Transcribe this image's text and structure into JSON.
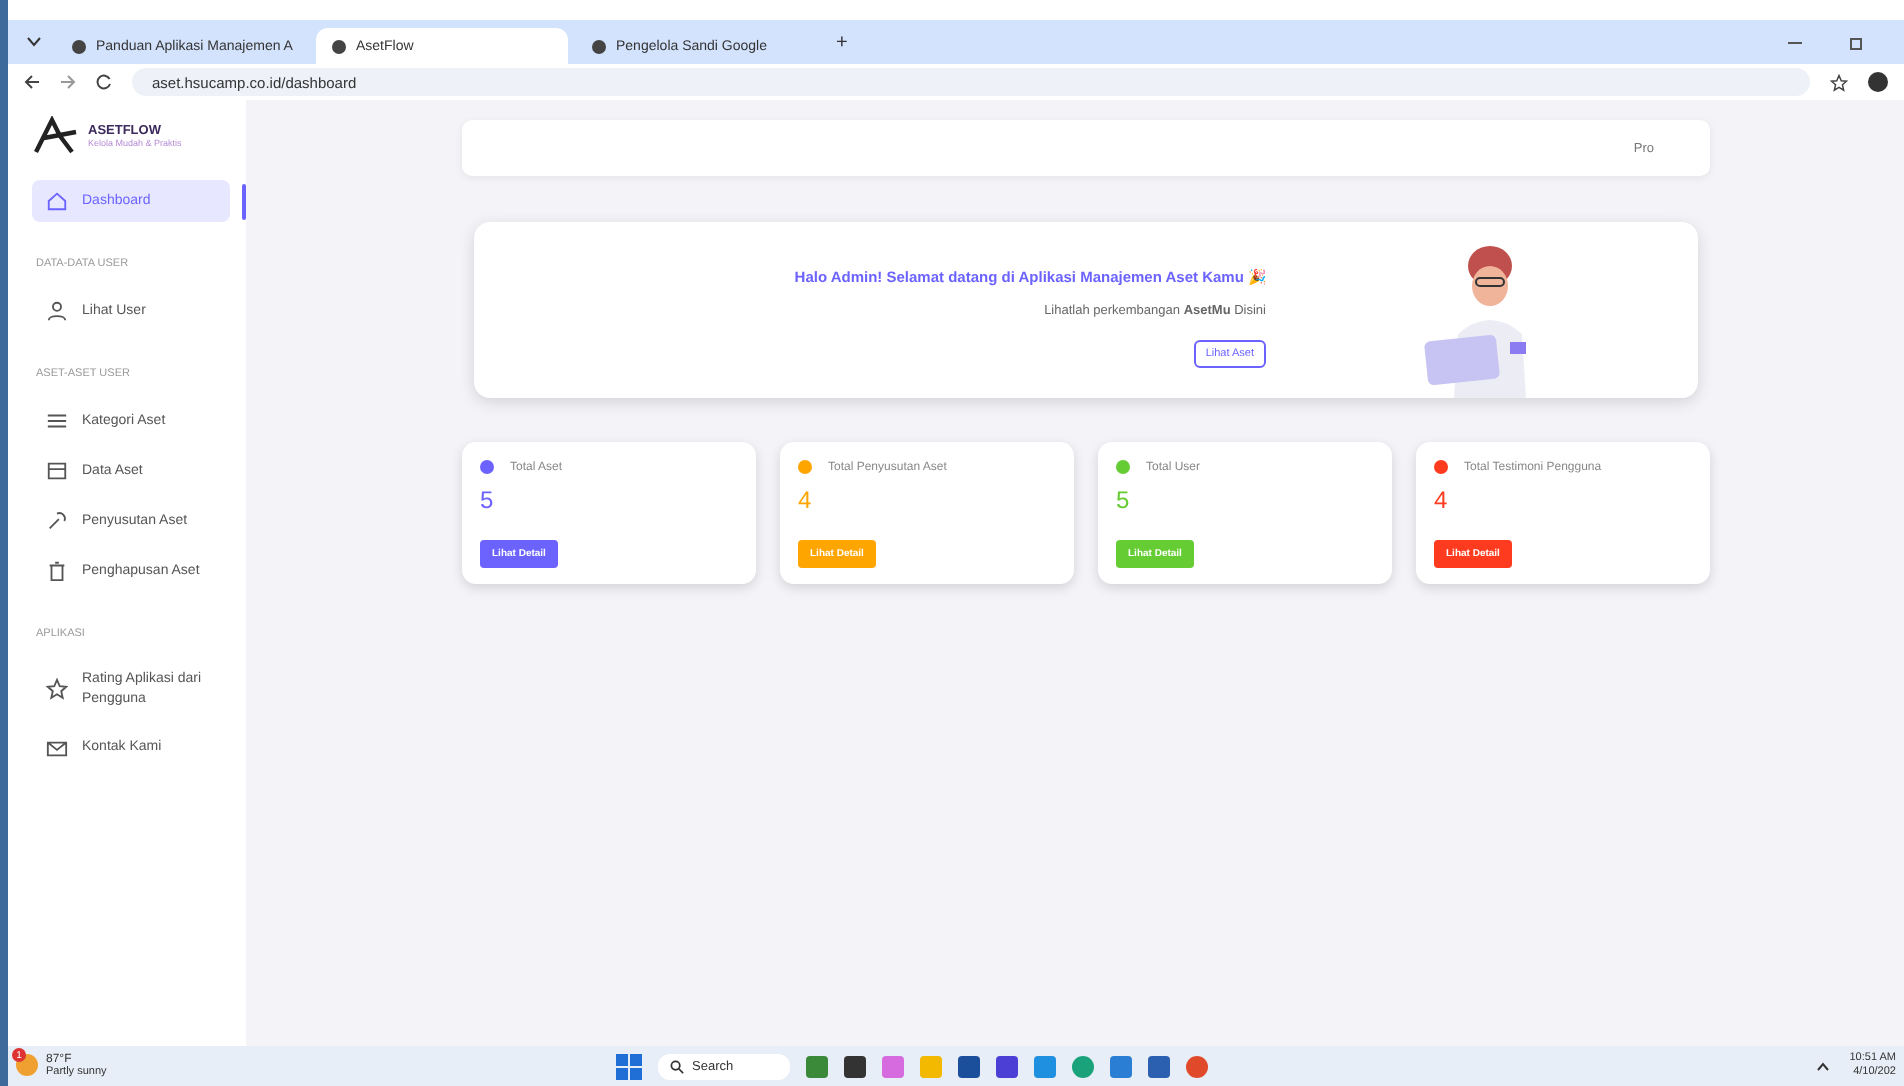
{
  "browser": {
    "tabs": [
      {
        "title": "Panduan Aplikasi Manajemen A",
        "selected": false
      },
      {
        "title": "AsetFlow",
        "selected": true
      },
      {
        "title": "Pengelola Sandi Google",
        "selected": false
      }
    ],
    "new_tab": "+",
    "url": "aset.hsucamp.co.id/dashboard"
  },
  "sidebar": {
    "logo": {
      "name": "ASETFLOW",
      "tagline": "Kelola Mudah & Praktis"
    },
    "items": [
      {
        "kind": "item",
        "label": "Dashboard",
        "selected": true
      },
      {
        "kind": "section",
        "label": "DATA-DATA USER"
      },
      {
        "kind": "item",
        "label": "Lihat User",
        "selected": false
      },
      {
        "kind": "section",
        "label": "ASET-ASET USER"
      },
      {
        "kind": "item",
        "label": "Kategori Aset",
        "selected": false
      },
      {
        "kind": "item",
        "label": "Data Aset",
        "selected": false
      },
      {
        "kind": "item",
        "label": "Penyusutan Aset",
        "selected": false
      },
      {
        "kind": "item",
        "label": "Penghapusan Aset",
        "selected": false
      },
      {
        "kind": "section",
        "label": "APLIKASI"
      },
      {
        "kind": "item",
        "label": "Rating Aplikasi dari Pengguna",
        "selected": false
      },
      {
        "kind": "item",
        "label": "Kontak Kami",
        "selected": false
      }
    ]
  },
  "header": {
    "profile_image_alt": "Pro"
  },
  "welcome": {
    "title": "Halo Admin! Selamat datang di Aplikasi Manajemen Aset Kamu 🎉",
    "subtitle": "Lihatlah perkembangan **AsetMu** Disini",
    "button": "Lihat Aset"
  },
  "stats": [
    {
      "label": "Total Aset",
      "value": "5",
      "color": "#6c63ff",
      "button": "Lihat Detail"
    },
    {
      "label": "Total Penyusutan Aset",
      "value": "4",
      "color": "#ffa500",
      "button": "Lihat Detail"
    },
    {
      "label": "Total User",
      "value": "5",
      "color": "#66cc33",
      "button": "Lihat Detail"
    },
    {
      "label": "Total Testimoni Pengguna",
      "value": "4",
      "color": "#ff3b1f",
      "button": "Lihat Detail"
    }
  ],
  "taskbar": {
    "weather_temp": "87°F",
    "weather_text": "Partly sunny",
    "weather_badge": "1",
    "search": "Search",
    "time": "10:51 AM",
    "date": "4/10/202"
  }
}
